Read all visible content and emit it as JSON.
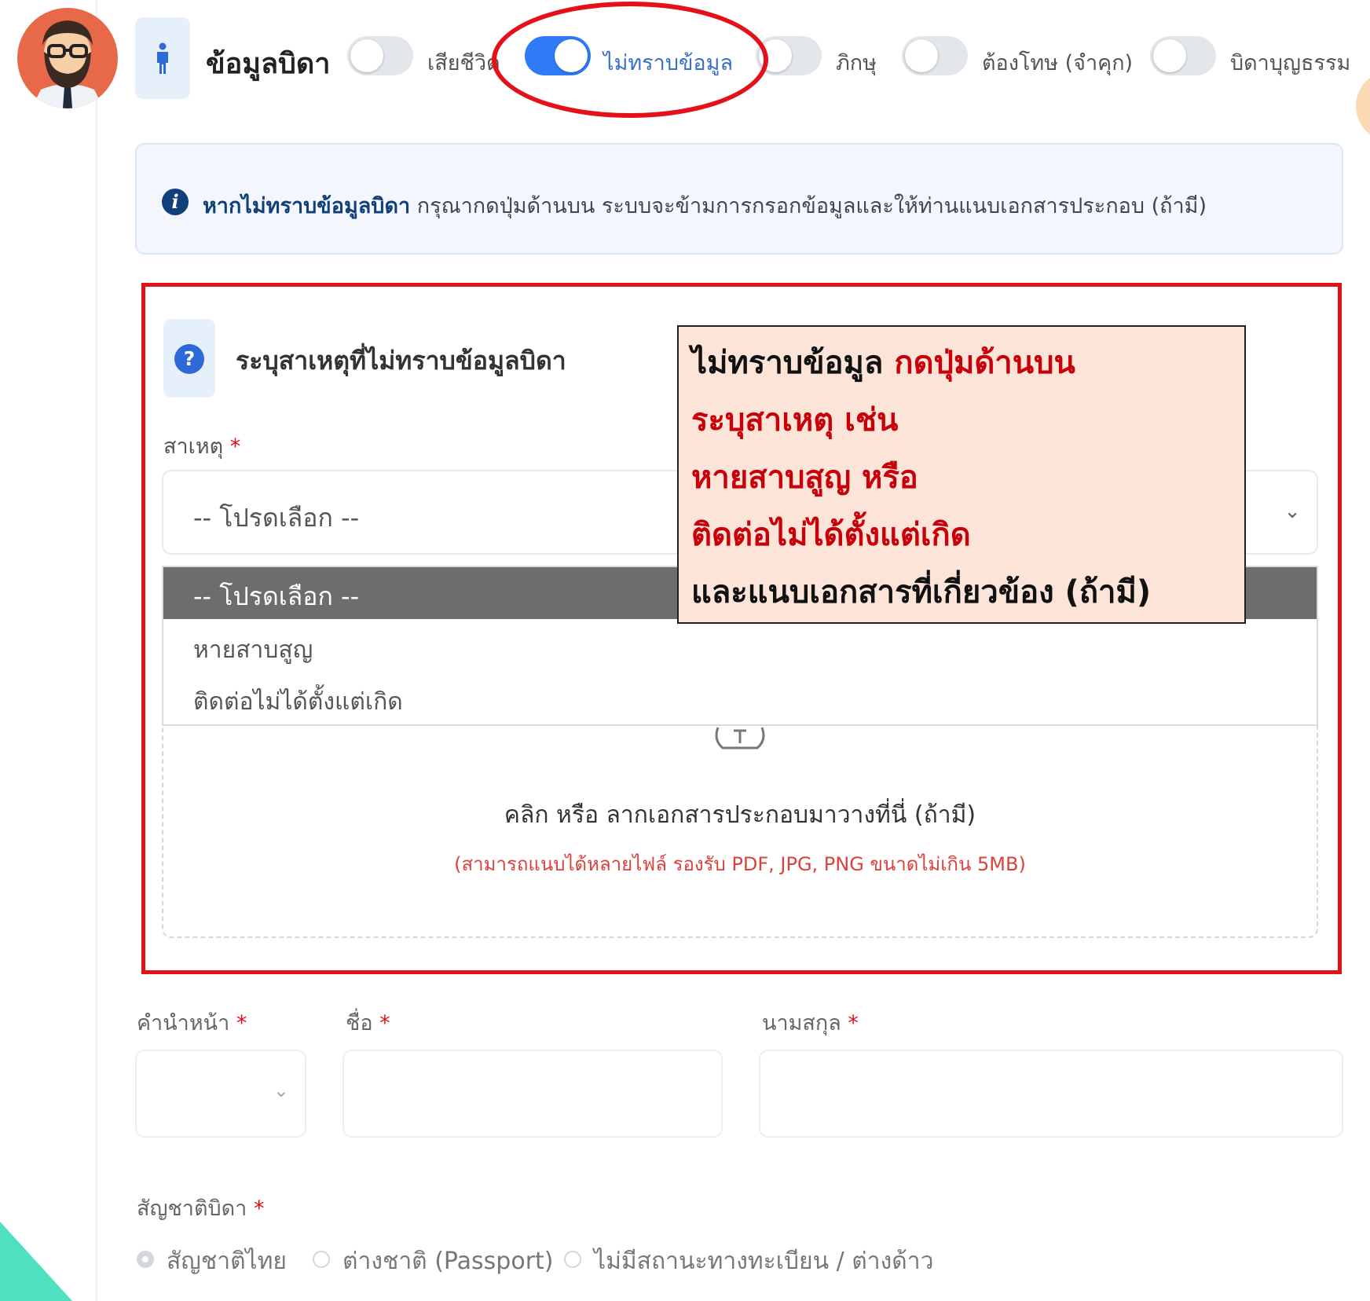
{
  "header": {
    "section_title": "ข้อมูลบิดา",
    "toggles": [
      {
        "label": "เสียชีวิต",
        "on": false
      },
      {
        "label": "ไม่ทราบข้อมูล",
        "on": true
      },
      {
        "label": "ภิกษุ",
        "on": false
      },
      {
        "label": "ต้องโทษ (จำคุก)",
        "on": false
      },
      {
        "label": "บิดาบุญธรรม",
        "on": false
      }
    ]
  },
  "alert": {
    "bold": "หากไม่ทราบข้อมูลบิดา",
    "text": " กรุณากดปุ่มด้านบน ระบบจะข้ามการกรอกข้อมูลและให้ท่านแนบเอกสารประกอบ (ถ้ามี)"
  },
  "reason": {
    "title": "ระบุสาเหตุที่ไม่ทราบข้อมูลบิดา",
    "label": "สาเหตุ",
    "required_mark": "*",
    "select_value": "-- โปรดเลือก --",
    "options": [
      "-- โปรดเลือก --",
      "หายสาบสูญ",
      "ติดต่อไม่ได้ตั้งแต่เกิด"
    ]
  },
  "upload": {
    "main": "คลิก หรือ ลากเอกสารประกอบมาวางที่นี่ (ถ้ามี)",
    "sub": "(สามารถแนบได้หลายไฟล์ รองรับ PDF, JPG, PNG ขนาดไม่เกิน 5MB)"
  },
  "annotation": {
    "line1a": "ไม่ทราบข้อมูล ",
    "line1b": "กดปุ่มด้านบน",
    "line2": "ระบุสาเหตุ เช่น",
    "line3": "หายสาบสูญ หรือ",
    "line4": "ติดต่อไม่ได้ตั้งแต่เกิด",
    "line5": "และแนบเอกสารที่เกี่ยวข้อง (ถ้ามี)"
  },
  "form": {
    "prefix_label": "คำนำหน้า",
    "first_name_label": "ชื่อ",
    "last_name_label": "นามสกุล",
    "nationality_label": "สัญชาติบิดา",
    "required_mark": "*",
    "nationality_options": [
      {
        "label": "สัญชาติไทย",
        "selected": true
      },
      {
        "label": "ต่างชาติ (Passport)",
        "selected": false
      },
      {
        "label": "ไม่มีสถานะทางทะเบียน / ต่างด้าว",
        "selected": false
      }
    ]
  },
  "colors": {
    "accent": "#2f7bf5",
    "annotation_red": "#e4101a",
    "teal": "#4fe0c0"
  }
}
